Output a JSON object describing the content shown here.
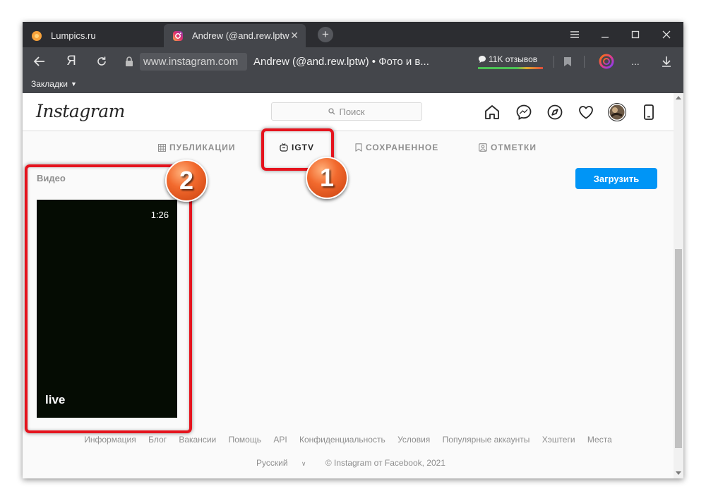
{
  "browser": {
    "tabs": [
      {
        "label": "Lumpics.ru",
        "active": false
      },
      {
        "label": "Andrew (@and.rew.lptw",
        "active": true
      }
    ],
    "url": "www.instagram.com",
    "page_title": "Andrew (@and.rew.lptw) • Фото и в...",
    "reviews": "11K отзывов",
    "bookmarks_label": "Закладки",
    "yandex_button": "Я",
    "more_button": "..."
  },
  "instagram": {
    "logo": "Instagram",
    "search_placeholder": "Поиск",
    "tabs": [
      {
        "label": "ПУБЛИКАЦИИ",
        "icon": "grid-icon",
        "active": false
      },
      {
        "label": "IGTV",
        "icon": "igtv-icon",
        "active": true
      },
      {
        "label": "СОХРАНЕННОЕ",
        "icon": "bookmark-icon",
        "active": false
      },
      {
        "label": "ОТМЕТКИ",
        "icon": "tagged-icon",
        "active": false
      }
    ],
    "section_title": "Видео",
    "upload_button": "Загрузить",
    "video": {
      "duration": "1:26",
      "title": "live"
    },
    "footer_links": [
      "Информация",
      "Блог",
      "Вакансии",
      "Помощь",
      "API",
      "Конфиденциальность",
      "Условия",
      "Популярные аккаунты",
      "Хэштеги",
      "Места"
    ],
    "language": "Русский",
    "copyright": "© Instagram от Facebook, 2021"
  },
  "annotations": [
    {
      "number": "1",
      "target": "IGTV tab"
    },
    {
      "number": "2",
      "target": "video card"
    }
  ],
  "colors": {
    "accent_blue": "#0095f6",
    "highlight_red": "#e5131d",
    "badge_orange": "#f26a2e",
    "browser_dark": "#44464b"
  }
}
